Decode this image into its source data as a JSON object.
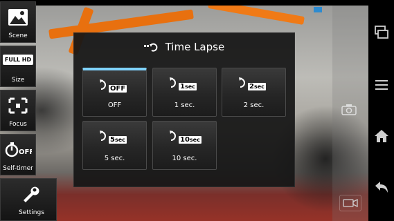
{
  "sidebar": {
    "items": [
      {
        "label": "Scene",
        "icon": "scene-icon"
      },
      {
        "label": "Size",
        "badge": "FULL HD",
        "icon": "full-hd-icon"
      },
      {
        "label": "Focus",
        "icon": "focus-icon"
      },
      {
        "label": "Self-timer",
        "badge": "OFF",
        "icon": "self-timer-icon"
      },
      {
        "label": "Settings",
        "icon": "wrench-icon"
      }
    ]
  },
  "dialog": {
    "title": "Time Lapse",
    "options": [
      {
        "badge_num": "",
        "badge_unit": "",
        "badge": "OFF",
        "label": "OFF",
        "selected": true
      },
      {
        "badge_num": "1",
        "badge_unit": "sec",
        "label": "1 sec.",
        "selected": false
      },
      {
        "badge_num": "2",
        "badge_unit": "sec",
        "label": "2 sec.",
        "selected": false
      },
      {
        "badge_num": "5",
        "badge_unit": "sec",
        "label": "5 sec.",
        "selected": false
      },
      {
        "badge_num": "10",
        "badge_unit": "sec",
        "label": "10 sec.",
        "selected": false
      }
    ]
  },
  "navbar": {
    "buttons": [
      "recent-apps-icon",
      "menu-icon",
      "home-icon",
      "back-icon"
    ]
  },
  "colors": {
    "accent": "#7fd3ff",
    "indicator": "#2d8bd0",
    "dialog_bg": "#161616"
  }
}
